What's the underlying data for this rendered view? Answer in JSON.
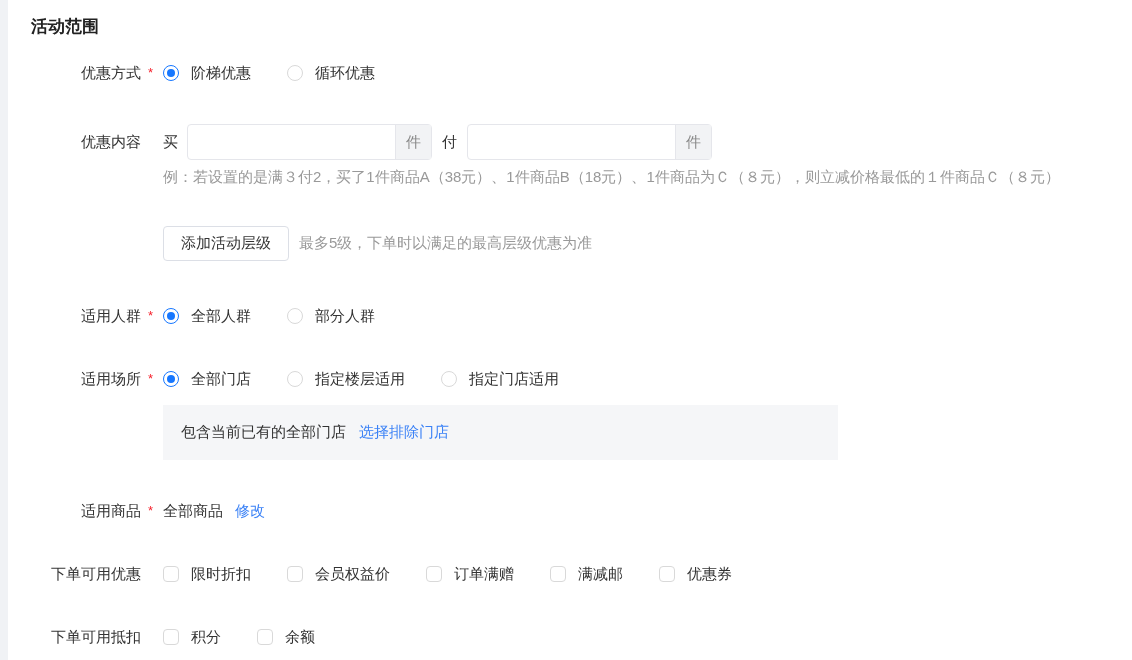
{
  "title": "活动范围",
  "rows": [
    {
      "kind": "radio",
      "label": "优惠方式",
      "required_mark": "*",
      "options": [
        {
          "label": "阶梯优惠",
          "selected": true
        },
        {
          "label": "循环优惠",
          "selected": false
        }
      ]
    },
    {
      "kind": "content",
      "label": "优惠内容",
      "buy_label": "买",
      "buy_unit": "件",
      "pay_label": "付",
      "pay_unit": "件",
      "hint": "例：若设置的是满３付2，买了1件商品A（38元）、1件商品B（18元）、1件商品为Ｃ（８元），则立减价格最低的１件商品Ｃ（８元）",
      "button": "添加活动层级",
      "button_note": "最多5级，下单时以满足的最高层级优惠为准"
    },
    {
      "kind": "radio",
      "label": "适用人群",
      "required_mark": "*",
      "options": [
        {
          "label": "全部人群",
          "selected": true
        },
        {
          "label": "部分人群",
          "selected": false
        }
      ]
    },
    {
      "kind": "radio",
      "label": "适用场所",
      "required_mark": "*",
      "options": [
        {
          "label": "全部门店",
          "selected": true
        },
        {
          "label": "指定楼层适用",
          "selected": false
        },
        {
          "label": "指定门店适用",
          "selected": false
        }
      ],
      "note": {
        "text": "包含当前已有的全部门店",
        "link": "选择排除门店"
      }
    },
    {
      "kind": "text",
      "label": "适用商品",
      "required_mark": "*",
      "value": "全部商品",
      "link": "修改"
    },
    {
      "kind": "checkbox",
      "label": "下单可用优惠",
      "options": [
        {
          "label": "限时折扣",
          "checked": false
        },
        {
          "label": "会员权益价",
          "checked": false
        },
        {
          "label": "订单满赠",
          "checked": false
        },
        {
          "label": "满减邮",
          "checked": false
        },
        {
          "label": "优惠券",
          "checked": false
        }
      ]
    },
    {
      "kind": "checkbox",
      "label": "下单可用抵扣",
      "options": [
        {
          "label": "积分",
          "checked": false
        },
        {
          "label": "余额",
          "checked": false
        }
      ]
    }
  ]
}
